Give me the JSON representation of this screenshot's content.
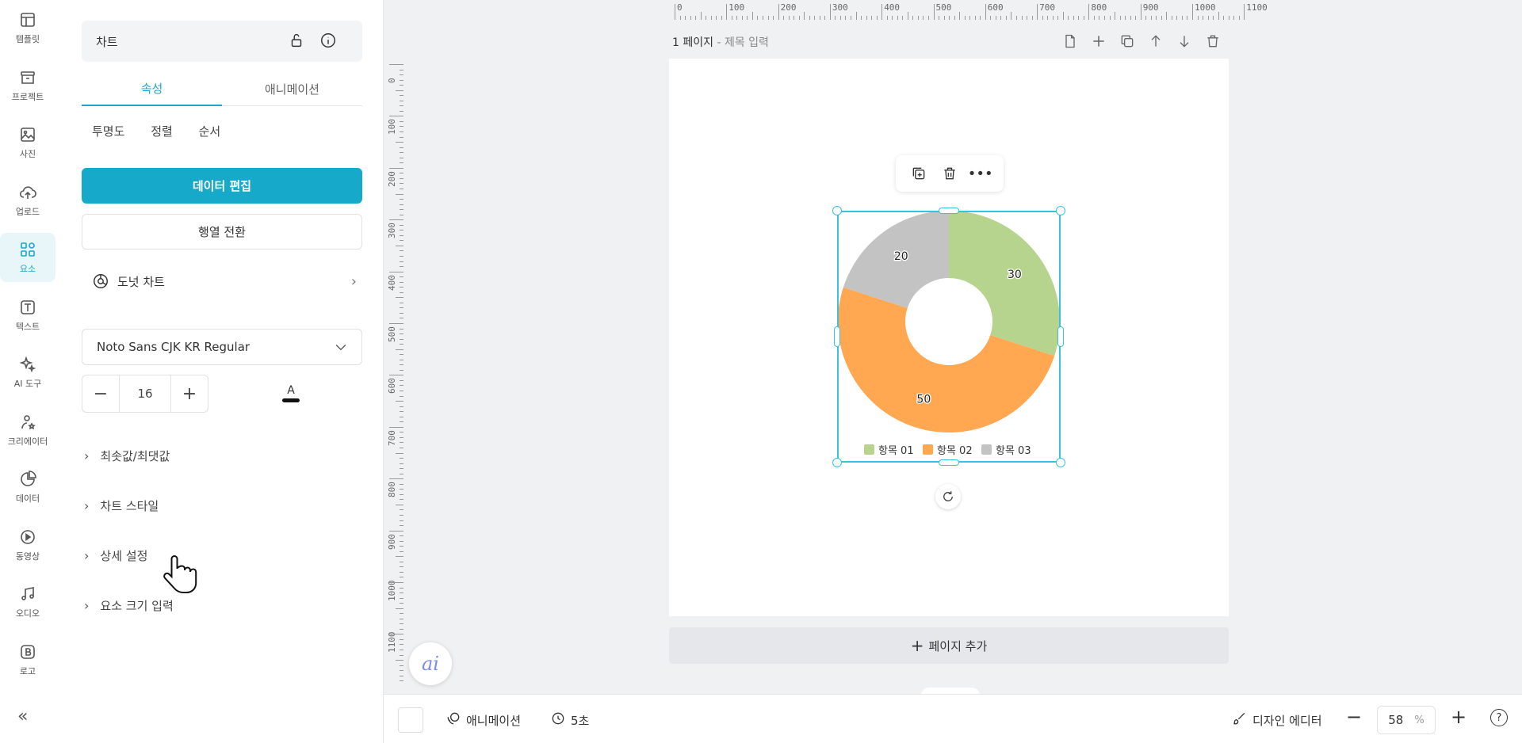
{
  "rail": {
    "items": [
      {
        "label": "템플릿",
        "icon": "template-icon"
      },
      {
        "label": "프로젝트",
        "icon": "project-icon"
      },
      {
        "label": "사진",
        "icon": "photo-icon"
      },
      {
        "label": "업로드",
        "icon": "upload-icon"
      },
      {
        "label": "요소",
        "icon": "elements-icon",
        "active": true
      },
      {
        "label": "텍스트",
        "icon": "text-icon"
      },
      {
        "label": "AI 도구",
        "icon": "ai-tools-icon"
      },
      {
        "label": "크리에이터",
        "icon": "creator-icon"
      },
      {
        "label": "데이터",
        "icon": "data-icon"
      },
      {
        "label": "동영상",
        "icon": "video-icon"
      },
      {
        "label": "오디오",
        "icon": "audio-icon"
      },
      {
        "label": "로고",
        "icon": "logo-icon"
      }
    ],
    "collapse": "«"
  },
  "panel": {
    "title": "차트",
    "tabs": [
      "속성",
      "애니메이션"
    ],
    "subopts": [
      "투명도",
      "정렬",
      "순서"
    ],
    "edit_data": "데이터 편집",
    "transpose": "행열 전환",
    "chart_type": "도넛 차트",
    "font_name": "Noto Sans CJK KR Regular",
    "font_size": "16",
    "text_color_glyph": "A",
    "sections": [
      "최솟값/최댓값",
      "차트 스타일",
      "상세 설정",
      "요소 크기 입력"
    ]
  },
  "ruler": {
    "top": [
      "0",
      "100",
      "200",
      "300",
      "400",
      "500",
      "600",
      "700",
      "800",
      "900",
      "1000",
      "1100"
    ],
    "left": [
      "0",
      "100",
      "200",
      "300",
      "400",
      "500",
      "600",
      "700",
      "800",
      "900",
      "1000",
      "1100"
    ]
  },
  "page": {
    "title": "1 페이지",
    "separator": " - ",
    "title_placeholder": "제목 입력",
    "add_page": "페이지 추가"
  },
  "chart_data": {
    "type": "pie",
    "variant": "donut",
    "categories": [
      "항목 01",
      "항목 02",
      "항목 03"
    ],
    "values": [
      30,
      50,
      20
    ],
    "colors": [
      "#b7d48f",
      "#ffa851",
      "#c3c3c3"
    ],
    "legend": "bottom",
    "data_labels": true
  },
  "bottom": {
    "animation": "애니메이션",
    "duration": "5초",
    "design_editor": "디자인 에디터",
    "zoom": "58",
    "zoom_unit": "%",
    "help": "?"
  },
  "colors": {
    "accent": "#16a9c9",
    "selection": "#39c2dd"
  }
}
